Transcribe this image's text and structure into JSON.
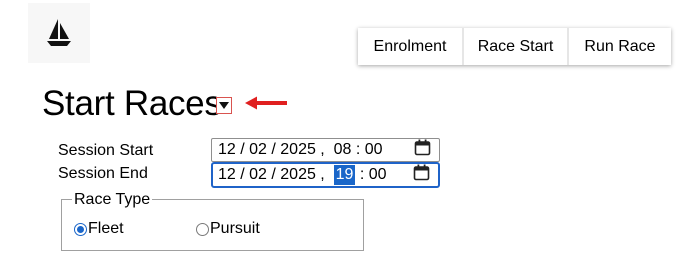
{
  "logo": {
    "icon": "sailboat-icon"
  },
  "nav": {
    "items": [
      {
        "label": "Enrolment"
      },
      {
        "label": "Race Start"
      },
      {
        "label": "Run Race"
      }
    ]
  },
  "page": {
    "title": "Start Races",
    "toggle_icon": "caret-down-icon",
    "annotation": {
      "icon": "arrow-left-icon",
      "color": "#e02020"
    }
  },
  "session": {
    "start": {
      "label": "Session Start",
      "date": "12 / 02 / 2025 ,",
      "hour": "08",
      "minute": "00"
    },
    "end": {
      "label": "Session End",
      "date": "12 / 02 / 2025 ,",
      "hour": "19",
      "minute": "00",
      "focused": true,
      "selected_segment": "hour"
    }
  },
  "race_type": {
    "legend": "Race Type",
    "options": [
      {
        "label": "Fleet",
        "selected": true
      },
      {
        "label": "Pursuit",
        "selected": false
      }
    ]
  },
  "colors": {
    "accent": "#1a66c9",
    "annotation": "#e02020",
    "toggle_border": "#d9534f"
  }
}
